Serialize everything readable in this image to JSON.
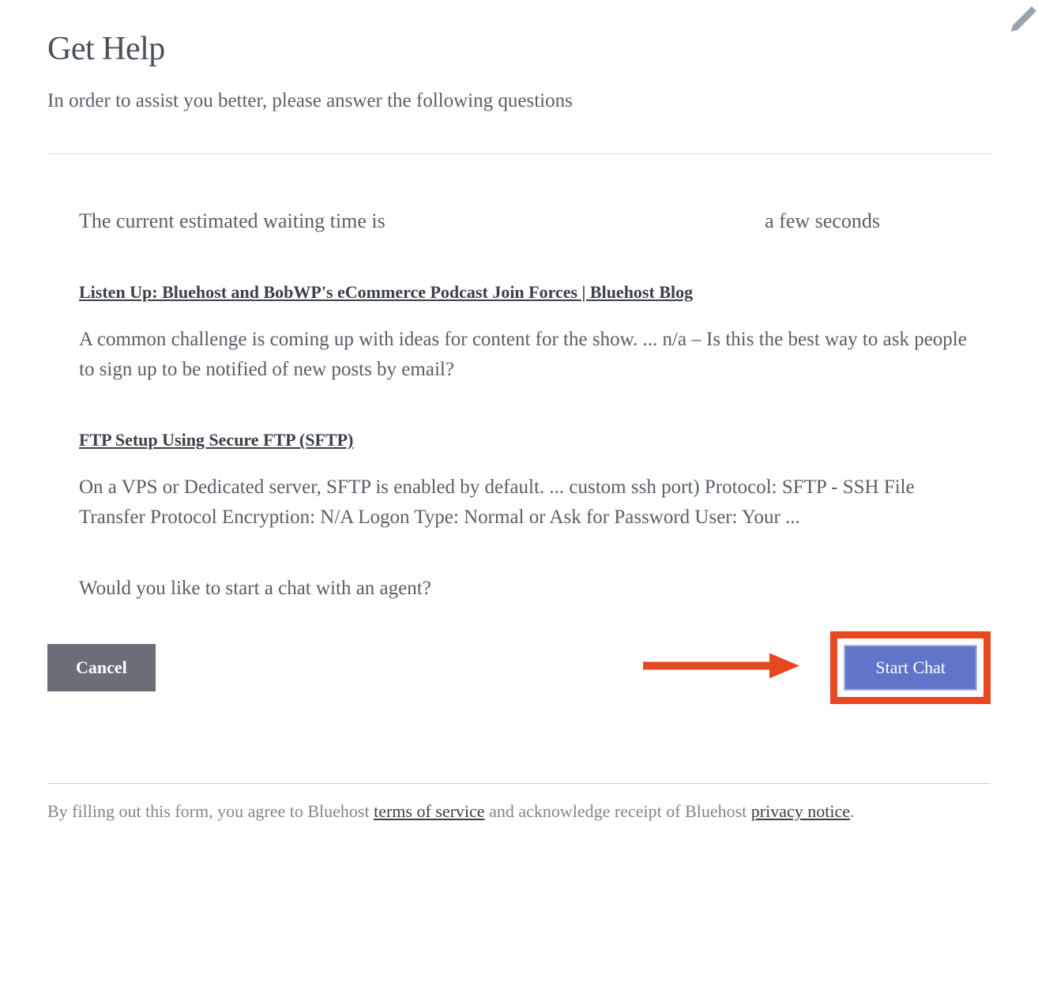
{
  "header": {
    "title": "Get Help",
    "subtitle": "In order to assist you better, please answer the following questions"
  },
  "wait": {
    "label": "The current estimated waiting time is",
    "value": "a few seconds"
  },
  "articles": [
    {
      "title": "Listen Up: Bluehost and BobWP's eCommerce Podcast Join Forces | Bluehost Blog",
      "desc": "A common challenge is coming up with ideas for content for the show. ... n/a – Is this the best way to ask people to sign up to be notified of new posts by email?"
    },
    {
      "title": "FTP Setup Using Secure FTP (SFTP)",
      "desc": "On a VPS or Dedicated server, SFTP is enabled by default. ... custom ssh port) Protocol: SFTP - SSH File Transfer Protocol Encryption: N/A Logon Type: Normal or Ask for Password User: Your ..."
    }
  ],
  "prompt": "Would you like to start a chat with an agent?",
  "buttons": {
    "cancel": "Cancel",
    "start": "Start Chat"
  },
  "footer": {
    "prefix": "By filling out this form, you agree to Bluehost ",
    "tos": "terms of service",
    "middle": " and acknowledge receipt of Bluehost ",
    "privacy": "privacy notice",
    "suffix": "."
  },
  "annotation": {
    "highlight_color": "#e8481f",
    "arrow_color": "#e8481f"
  }
}
